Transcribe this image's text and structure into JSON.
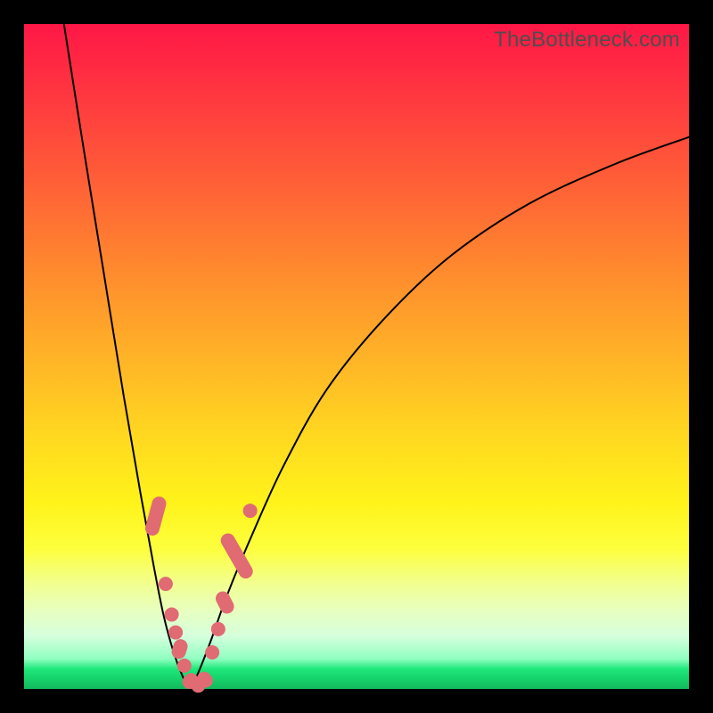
{
  "watermark": "TheBottleneck.com",
  "colors": {
    "marker": "#e06b73",
    "curve": "#000000"
  },
  "chart_data": {
    "type": "line",
    "title": "",
    "xlabel": "",
    "ylabel": "",
    "xlim": [
      0,
      1
    ],
    "ylim": [
      0,
      1
    ],
    "note": "Axes are unlabeled; values are normalized 0–1 estimates read from pixel positions. y is inverted for plotting (0 = top of plot area).",
    "series": [
      {
        "name": "left-branch",
        "x": [
          0.06,
          0.09,
          0.12,
          0.15,
          0.175,
          0.195,
          0.21,
          0.225,
          0.238,
          0.248
        ],
        "y": [
          1.0,
          0.81,
          0.625,
          0.44,
          0.295,
          0.185,
          0.11,
          0.055,
          0.02,
          0.002
        ]
      },
      {
        "name": "right-branch",
        "x": [
          0.248,
          0.26,
          0.28,
          0.305,
          0.34,
          0.39,
          0.455,
          0.54,
          0.64,
          0.76,
          0.89,
          1.0
        ],
        "y": [
          0.002,
          0.02,
          0.07,
          0.14,
          0.225,
          0.335,
          0.45,
          0.555,
          0.65,
          0.73,
          0.79,
          0.83
        ]
      }
    ],
    "markers": {
      "name": "highlighted-points",
      "note": "Salmon-colored dots/pills overlaid on the curve near the trough.",
      "points": [
        {
          "x": 0.198,
          "y": 0.26,
          "shape": "pill",
          "angle": -75,
          "len": 0.06
        },
        {
          "x": 0.213,
          "y": 0.158,
          "shape": "dot"
        },
        {
          "x": 0.222,
          "y": 0.112,
          "shape": "dot"
        },
        {
          "x": 0.228,
          "y": 0.085,
          "shape": "dot"
        },
        {
          "x": 0.234,
          "y": 0.06,
          "shape": "pill",
          "angle": -72,
          "len": 0.03
        },
        {
          "x": 0.241,
          "y": 0.035,
          "shape": "dot"
        },
        {
          "x": 0.25,
          "y": 0.012,
          "shape": "pill",
          "angle": -45,
          "len": 0.025
        },
        {
          "x": 0.262,
          "y": 0.005,
          "shape": "dot"
        },
        {
          "x": 0.272,
          "y": 0.014,
          "shape": "pill",
          "angle": 45,
          "len": 0.025
        },
        {
          "x": 0.283,
          "y": 0.055,
          "shape": "dot"
        },
        {
          "x": 0.292,
          "y": 0.09,
          "shape": "dot"
        },
        {
          "x": 0.302,
          "y": 0.13,
          "shape": "pill",
          "angle": 63,
          "len": 0.035
        },
        {
          "x": 0.32,
          "y": 0.2,
          "shape": "pill",
          "angle": 60,
          "len": 0.075
        },
        {
          "x": 0.34,
          "y": 0.268,
          "shape": "dot"
        }
      ]
    }
  }
}
